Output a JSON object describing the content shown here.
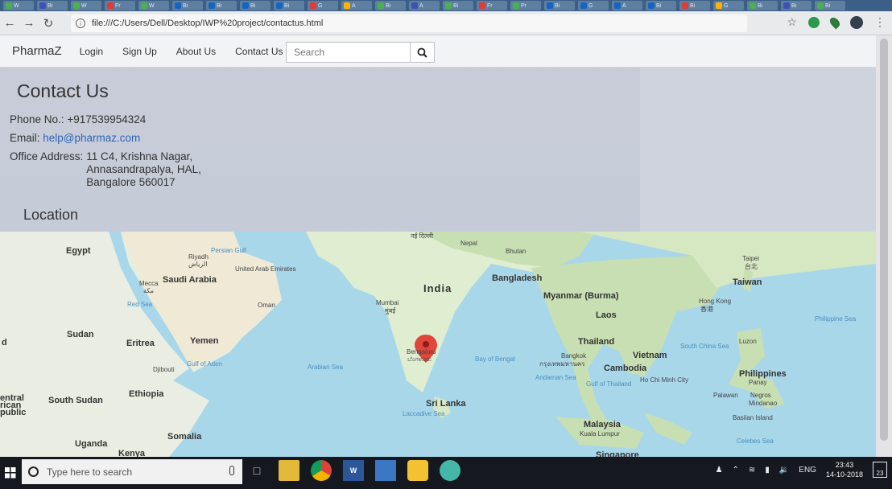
{
  "browser": {
    "url": "file:///C:/Users/Dell/Desktop/IWP%20project/contactus.html",
    "tabs": [
      "W",
      "Bi",
      "W",
      "Fr",
      "W",
      "Bi",
      "Bi",
      "Bi",
      "Bi",
      "G",
      "A",
      "Bi",
      "A",
      "Bi",
      "Fr",
      "Pr",
      "Bi",
      "G",
      "A",
      "Bi",
      "Bi",
      "G",
      "Bi",
      "Bi",
      "Bi"
    ]
  },
  "site": {
    "brand": "PharmaZ",
    "nav": [
      "Login",
      "Sign Up",
      "About Us",
      "Contact Us"
    ],
    "search_placeholder": "Search"
  },
  "contact": {
    "title": "Contact Us",
    "phone_label": "Phone No.:",
    "phone": "+917539954324",
    "email_label": "Email:",
    "email": "help@pharmaz.com",
    "address_label": "Office Address:",
    "address_lines": [
      "11 C4, Krishna Nagar,",
      "Annasandrapalya, HAL,",
      "Bangalore 560017"
    ],
    "location_heading": "Location"
  },
  "map": {
    "countries": [
      "Egypt",
      "Saudi Arabia",
      "United Arab Emirates",
      "Oman",
      "Yemen",
      "Sudan",
      "Eritrea",
      "Djibouti",
      "Ethiopia",
      "South Sudan",
      "Somalia",
      "Uganda",
      "Kenya",
      "India",
      "Nepal",
      "Bhutan",
      "Bangladesh",
      "Myanmar (Burma)",
      "Laos",
      "Thailand",
      "Vietnam",
      "Cambodia",
      "Sri Lanka",
      "Malaysia",
      "Singapore",
      "Taiwan",
      "Philippines"
    ],
    "cities": [
      "Riyadh",
      "الرياض",
      "Mecca",
      "مكة",
      "Mumbai",
      "मुंबई",
      "Bengaluru",
      "ಬೆಂಗಳೂರು",
      "Bangkok",
      "กรุงเทพมหานคร",
      "Ho Chi Minh City",
      "Hong Kong",
      "香港",
      "Taipei",
      "台北",
      "Kuala Lumpur",
      "Luzon",
      "Panay",
      "Negros",
      "Mindanao",
      "Palawan",
      "Basilan Island",
      "नई दिल्ली"
    ],
    "seas": [
      "Persian Gulf",
      "Red Sea",
      "Gulf of Aden",
      "Arabian Sea",
      "Laccadive Sea",
      "Bay of Bengal",
      "Andaman Sea",
      "Gulf of Thailand",
      "South China Sea",
      "Philippine Sea",
      "Celebes Sea"
    ],
    "edge_labels": [
      "d",
      "entral",
      "rican",
      "public"
    ]
  },
  "taskbar": {
    "search_placeholder": "Type here to search",
    "apps": [
      "file-explorer",
      "chrome",
      "word",
      "store",
      "paint",
      "edge"
    ],
    "language": "ENG",
    "time": "23:43",
    "date": "14-10-2018",
    "notification_count": "23"
  },
  "colors": {
    "page_bg": "#c8cdd9",
    "link": "#2d66b8",
    "water": "#a9d7ea",
    "land": "#e6eee0",
    "land_green": "#c7dfb2",
    "marker": "#e0463b"
  }
}
